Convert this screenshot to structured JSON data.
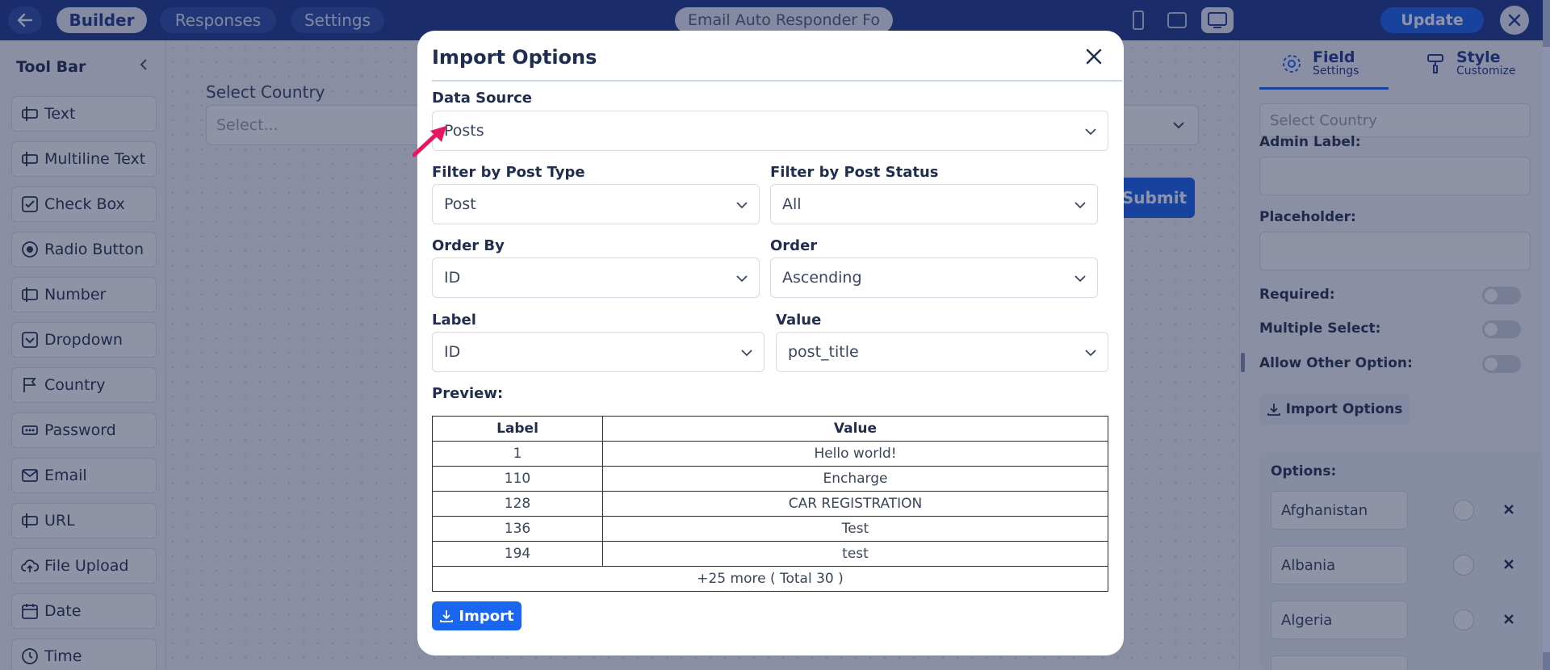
{
  "topbar": {
    "tabs": [
      "Builder",
      "Responses",
      "Settings"
    ],
    "form_title": "Email Auto Responder Fo",
    "update_label": "Update"
  },
  "toolbar": {
    "title": "Tool Bar",
    "items": [
      {
        "label": "Text",
        "icon": "text-cursor-icon"
      },
      {
        "label": "Multiline Text",
        "icon": "multiline-text-icon"
      },
      {
        "label": "Check Box",
        "icon": "checkbox-icon"
      },
      {
        "label": "Radio Button",
        "icon": "radio-icon"
      },
      {
        "label": "Number",
        "icon": "number-icon"
      },
      {
        "label": "Dropdown",
        "icon": "dropdown-icon"
      },
      {
        "label": "Country",
        "icon": "flag-icon"
      },
      {
        "label": "Password",
        "icon": "password-icon"
      },
      {
        "label": "Email",
        "icon": "envelope-icon"
      },
      {
        "label": "URL",
        "icon": "url-icon"
      },
      {
        "label": "File Upload",
        "icon": "upload-icon"
      },
      {
        "label": "Date",
        "icon": "calendar-icon"
      },
      {
        "label": "Time",
        "icon": "clock-icon"
      }
    ]
  },
  "canvas": {
    "field_label": "Select Country",
    "field_placeholder": "Select...",
    "submit_label": "Submit"
  },
  "right_panel": {
    "tabs": [
      {
        "title": "Field",
        "subtitle": "Settings"
      },
      {
        "title": "Style",
        "subtitle": "Customize"
      }
    ],
    "country_value": "Select Country",
    "admin_label": "Admin Label:",
    "placeholder_label": "Placeholder:",
    "required_label": "Required:",
    "multiple_select_label": "Multiple Select:",
    "allow_other_label": "Allow Other Option:",
    "import_options_label": "Import Options",
    "options_title": "Options:",
    "options": [
      "Afghanistan",
      "Albania",
      "Algeria"
    ]
  },
  "modal": {
    "title": "Import Options",
    "data_source": {
      "label": "Data Source",
      "value": "Posts"
    },
    "post_type": {
      "label": "Filter by Post Type",
      "value": "Post"
    },
    "post_status": {
      "label": "Filter by Post Status",
      "value": "All"
    },
    "order_by": {
      "label": "Order By",
      "value": "ID"
    },
    "order": {
      "label": "Order",
      "value": "Ascending"
    },
    "label_field": {
      "label": "Label",
      "value": "ID"
    },
    "value_field": {
      "label": "Value",
      "value": "post_title"
    },
    "preview_label": "Preview:",
    "table": {
      "headers": [
        "Label",
        "Value"
      ],
      "rows": [
        [
          "1",
          "Hello world!"
        ],
        [
          "110",
          "Encharge"
        ],
        [
          "128",
          "CAR REGISTRATION"
        ],
        [
          "136",
          "Test"
        ],
        [
          "194",
          "test"
        ]
      ],
      "more": "+25 more ( Total 30 )"
    },
    "import_label": "Import"
  },
  "colors": {
    "primary": "#1a66f0",
    "navbar": "#1f3a8a",
    "arrow": "#e8165f"
  }
}
